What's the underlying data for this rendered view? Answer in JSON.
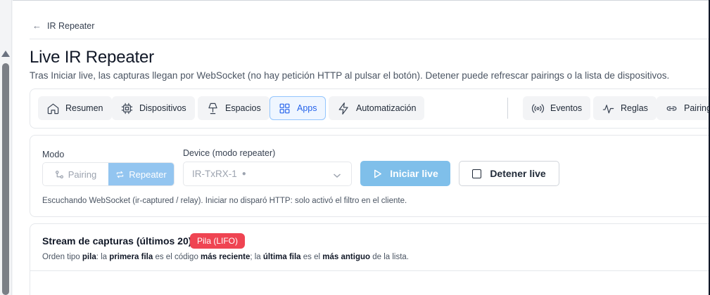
{
  "breadcrumb": {
    "label": "IR Repeater"
  },
  "page": {
    "title": "Live IR Repeater",
    "description": "Tras Iniciar live, las capturas llegan por WebSocket (no hay petición HTTP al pulsar el botón). Detener puede refrescar pairings o la lista de dispositivos."
  },
  "tabs": [
    {
      "label": "Resumen",
      "icon": "home-icon"
    },
    {
      "label": "Dispositivos",
      "icon": "chip-icon"
    },
    {
      "label": "Espacios",
      "icon": "lamp-icon"
    },
    {
      "label": "Apps",
      "icon": "grid-icon",
      "active": true
    },
    {
      "label": "Automatización",
      "icon": "bolt-icon"
    },
    {
      "label": "Eventos",
      "icon": "broadcast-icon"
    },
    {
      "label": "Reglas",
      "icon": "activity-icon"
    },
    {
      "label": "Pairings",
      "icon": "link-icon"
    }
  ],
  "mode": {
    "label": "Modo",
    "options": {
      "pairing": "Pairing",
      "repeater": "Repeater"
    },
    "selected": "Repeater"
  },
  "device": {
    "label": "Device (modo repeater)",
    "value": "IR-TxRX-1",
    "status_dot": "●"
  },
  "actions": {
    "start_label": "Iniciar live",
    "stop_label": "Detener live"
  },
  "listen_note": "Escuchando WebSocket (ir-captured / relay). Iniciar no disparó HTTP: solo activó el filtro en el cliente.",
  "stream": {
    "title": "Stream de capturas (últimos 20)",
    "badge": "Pila (LIFO)",
    "desc": {
      "t1": "Orden tipo ",
      "b1": "pila",
      "t2": ": la ",
      "b2": "primera fila",
      "t3": " es el código ",
      "b3": "más reciente",
      "t4": "; la ",
      "b4": "última fila",
      "t5": " es el ",
      "b5": "más antiguo",
      "t6": " de la lista."
    }
  },
  "colors": {
    "accent": "#2563eb",
    "primary_button": "#7fbfea",
    "badge": "#ef4452"
  }
}
